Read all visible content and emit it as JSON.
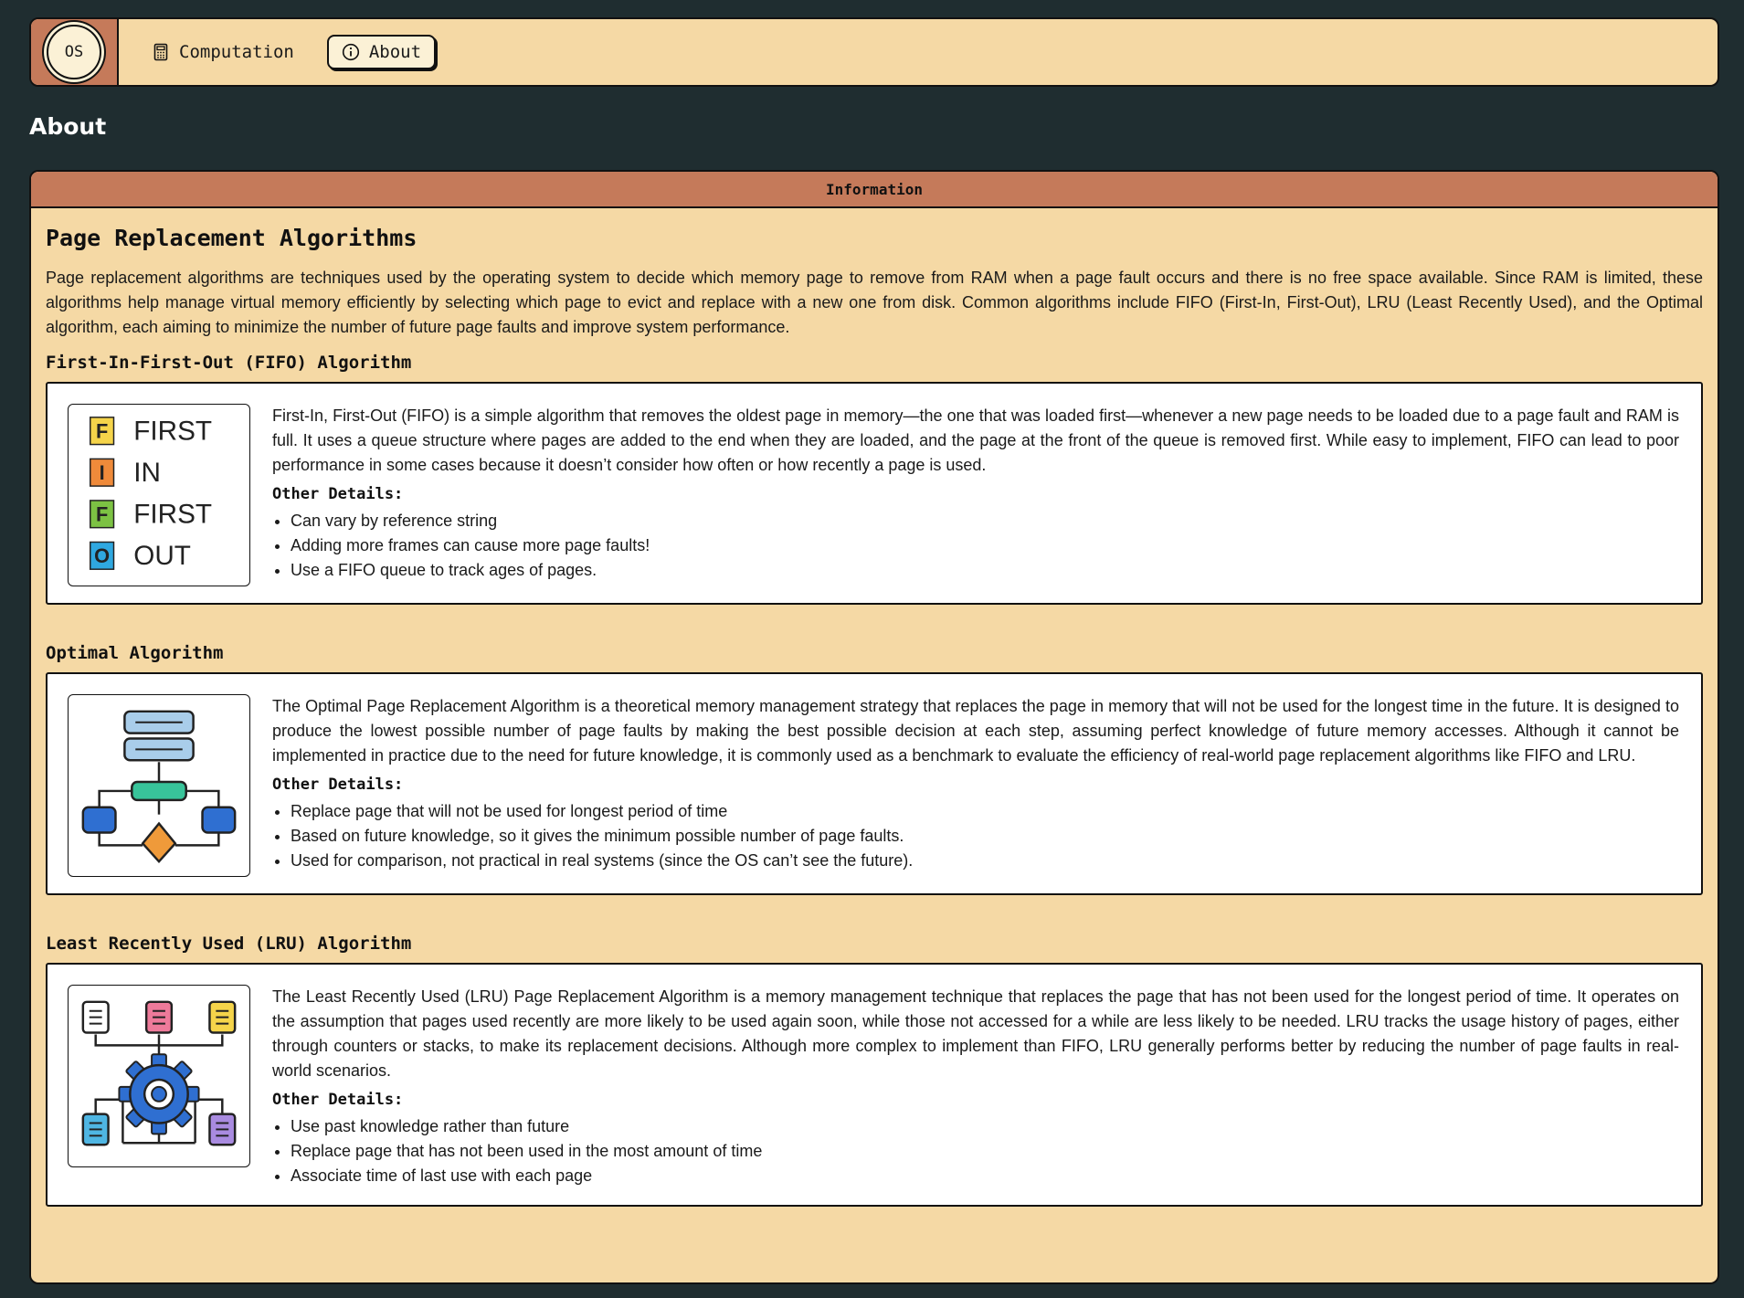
{
  "nav": {
    "logo_text": "OS",
    "items": [
      {
        "label": "Computation",
        "icon": "calculator-icon"
      },
      {
        "label": "About",
        "icon": "info-icon",
        "active": true
      }
    ]
  },
  "page": {
    "title": "About"
  },
  "panel": {
    "header": "Information",
    "heading": "Page Replacement Algorithms",
    "intro": "Page replacement algorithms are techniques used by the operating system to decide which memory page to remove from RAM when a page fault occurs and there is no free space available. Since RAM is limited, these algorithms help manage virtual memory efficiently by selecting which page to evict and replace with a new one from disk. Common algorithms include FIFO (First-In, First-Out), LRU (Least Recently Used), and the Optimal algorithm, each aiming to minimize the number of future page faults and improve system performance.",
    "details_label": "Other Details:"
  },
  "sections": [
    {
      "title": "First-In-First-Out (FIFO) Algorithm",
      "image": "fifo-illustration",
      "image_letters": [
        {
          "letter": "F",
          "word": "FIRST",
          "color": "#f5d44a"
        },
        {
          "letter": "I",
          "word": "IN",
          "color": "#ef8a3a"
        },
        {
          "letter": "F",
          "word": "FIRST",
          "color": "#7cc243"
        },
        {
          "letter": "O",
          "word": "OUT",
          "color": "#2fa8e0"
        }
      ],
      "description": "First-In, First-Out (FIFO) is a simple algorithm that removes the oldest page in memory—the one that was loaded first—whenever a new page needs to be loaded due to a page fault and RAM is full. It uses a queue structure where pages are added to the end when they are loaded, and the page at the front of the queue is removed first. While easy to implement, FIFO can lead to poor performance in some cases because it doesn’t consider how often or how recently a page is used.",
      "details": [
        "Can vary by reference string",
        "Adding more frames can cause more page faults!",
        "Use a FIFO queue to track ages of pages."
      ]
    },
    {
      "title": "Optimal Algorithm",
      "image": "flowchart-illustration",
      "description": "The Optimal Page Replacement Algorithm is a theoretical memory management strategy that replaces the page in memory that will not be used for the longest time in the future. It is designed to produce the lowest possible number of page faults by making the best possible decision at each step, assuming perfect knowledge of future memory accesses. Although it cannot be implemented in practice due to the need for future knowledge, it is commonly used as a benchmark to evaluate the efficiency of real-world page replacement algorithms like FIFO and LRU.",
      "details": [
        "Replace page that will not be used for longest period of time",
        "Based on future knowledge, so it gives the minimum possible number of page faults.",
        "Used for comparison, not practical in real systems (since the OS can’t see the future)."
      ]
    },
    {
      "title": "Least Recently Used (LRU) Algorithm",
      "image": "gear-network-illustration",
      "description": "The Least Recently Used (LRU) Page Replacement Algorithm is a memory management technique that replaces the page that has not been used for the longest period of time. It operates on the assumption that pages used recently are more likely to be used again soon, while those not accessed for a while are less likely to be needed. LRU tracks the usage history of pages, either through counters or stacks, to make its replacement decisions. Although more complex to implement than FIFO, LRU generally performs better by reducing the number of page faults in real-world scenarios.",
      "details": [
        "Use past knowledge rather than future",
        "Replace page that has not been used in the most amount of time",
        "Associate time of last use with each page"
      ]
    }
  ],
  "colors": {
    "background": "#1f2d30",
    "panel": "#f5d9a5",
    "accent": "#c57a5a",
    "card": "#ffffff"
  }
}
